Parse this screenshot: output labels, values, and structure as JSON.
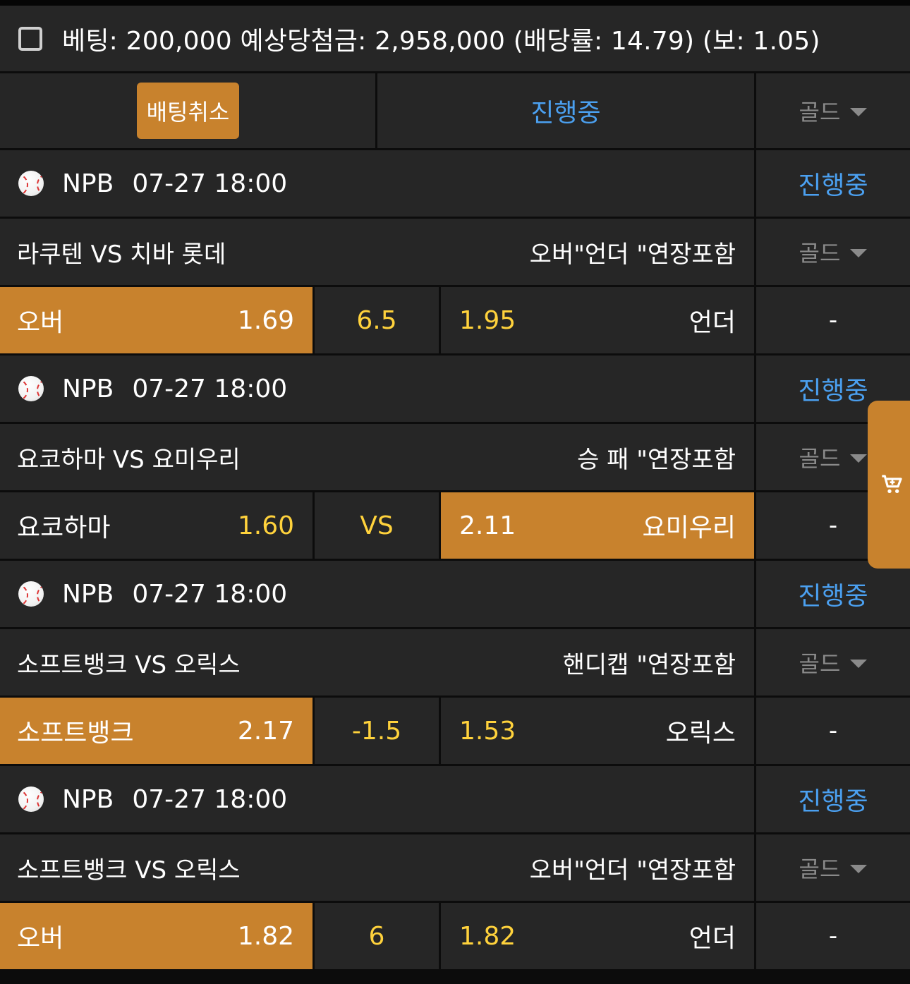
{
  "summary": {
    "text": "베팅: 200,000 예상당첨금: 2,958,000 (배당률: 14.79) (보: 1.05)"
  },
  "controls": {
    "cancel_label": "배팅취소",
    "status_label": "진행중",
    "gold_label": "골드"
  },
  "colors": {
    "accent": "#c8822d",
    "status_blue": "#4ba0f0",
    "odds_yellow": "#ffd23c",
    "cell_bg": "#262626",
    "page_bg": "#0c0c0c"
  },
  "bets": [
    {
      "league": "NPB",
      "datetime": "07-27 18:00",
      "status": "진행중",
      "match": "라쿠텐 VS 치바 롯데",
      "market": "오버\"언더 \"연장포함",
      "gold": "골드",
      "home_name": "오버",
      "home_odds": "1.69",
      "middle": "6.5",
      "away_odds": "1.95",
      "away_name": "언더",
      "result": "-",
      "selected": "home"
    },
    {
      "league": "NPB",
      "datetime": "07-27 18:00",
      "status": "진행중",
      "match": "요코하마 VS 요미우리",
      "market": "승 패 \"연장포함",
      "gold": "골드",
      "home_name": "요코하마",
      "home_odds": "1.60",
      "middle": "VS",
      "away_odds": "2.11",
      "away_name": "요미우리",
      "result": "-",
      "selected": "away"
    },
    {
      "league": "NPB",
      "datetime": "07-27 18:00",
      "status": "진행중",
      "match": "소프트뱅크 VS 오릭스",
      "market": "핸디캡 \"연장포함",
      "gold": "골드",
      "home_name": "소프트뱅크",
      "home_odds": "2.17",
      "middle": "-1.5",
      "away_odds": "1.53",
      "away_name": "오릭스",
      "result": "-",
      "selected": "home"
    },
    {
      "league": "NPB",
      "datetime": "07-27 18:00",
      "status": "진행중",
      "match": "소프트뱅크 VS 오릭스",
      "market": "오버\"언더 \"연장포함",
      "gold": "골드",
      "home_name": "오버",
      "home_odds": "1.82",
      "middle": "6",
      "away_odds": "1.82",
      "away_name": "언더",
      "result": "-",
      "selected": "home"
    }
  ],
  "cart": {
    "icon": "cart-icon"
  }
}
